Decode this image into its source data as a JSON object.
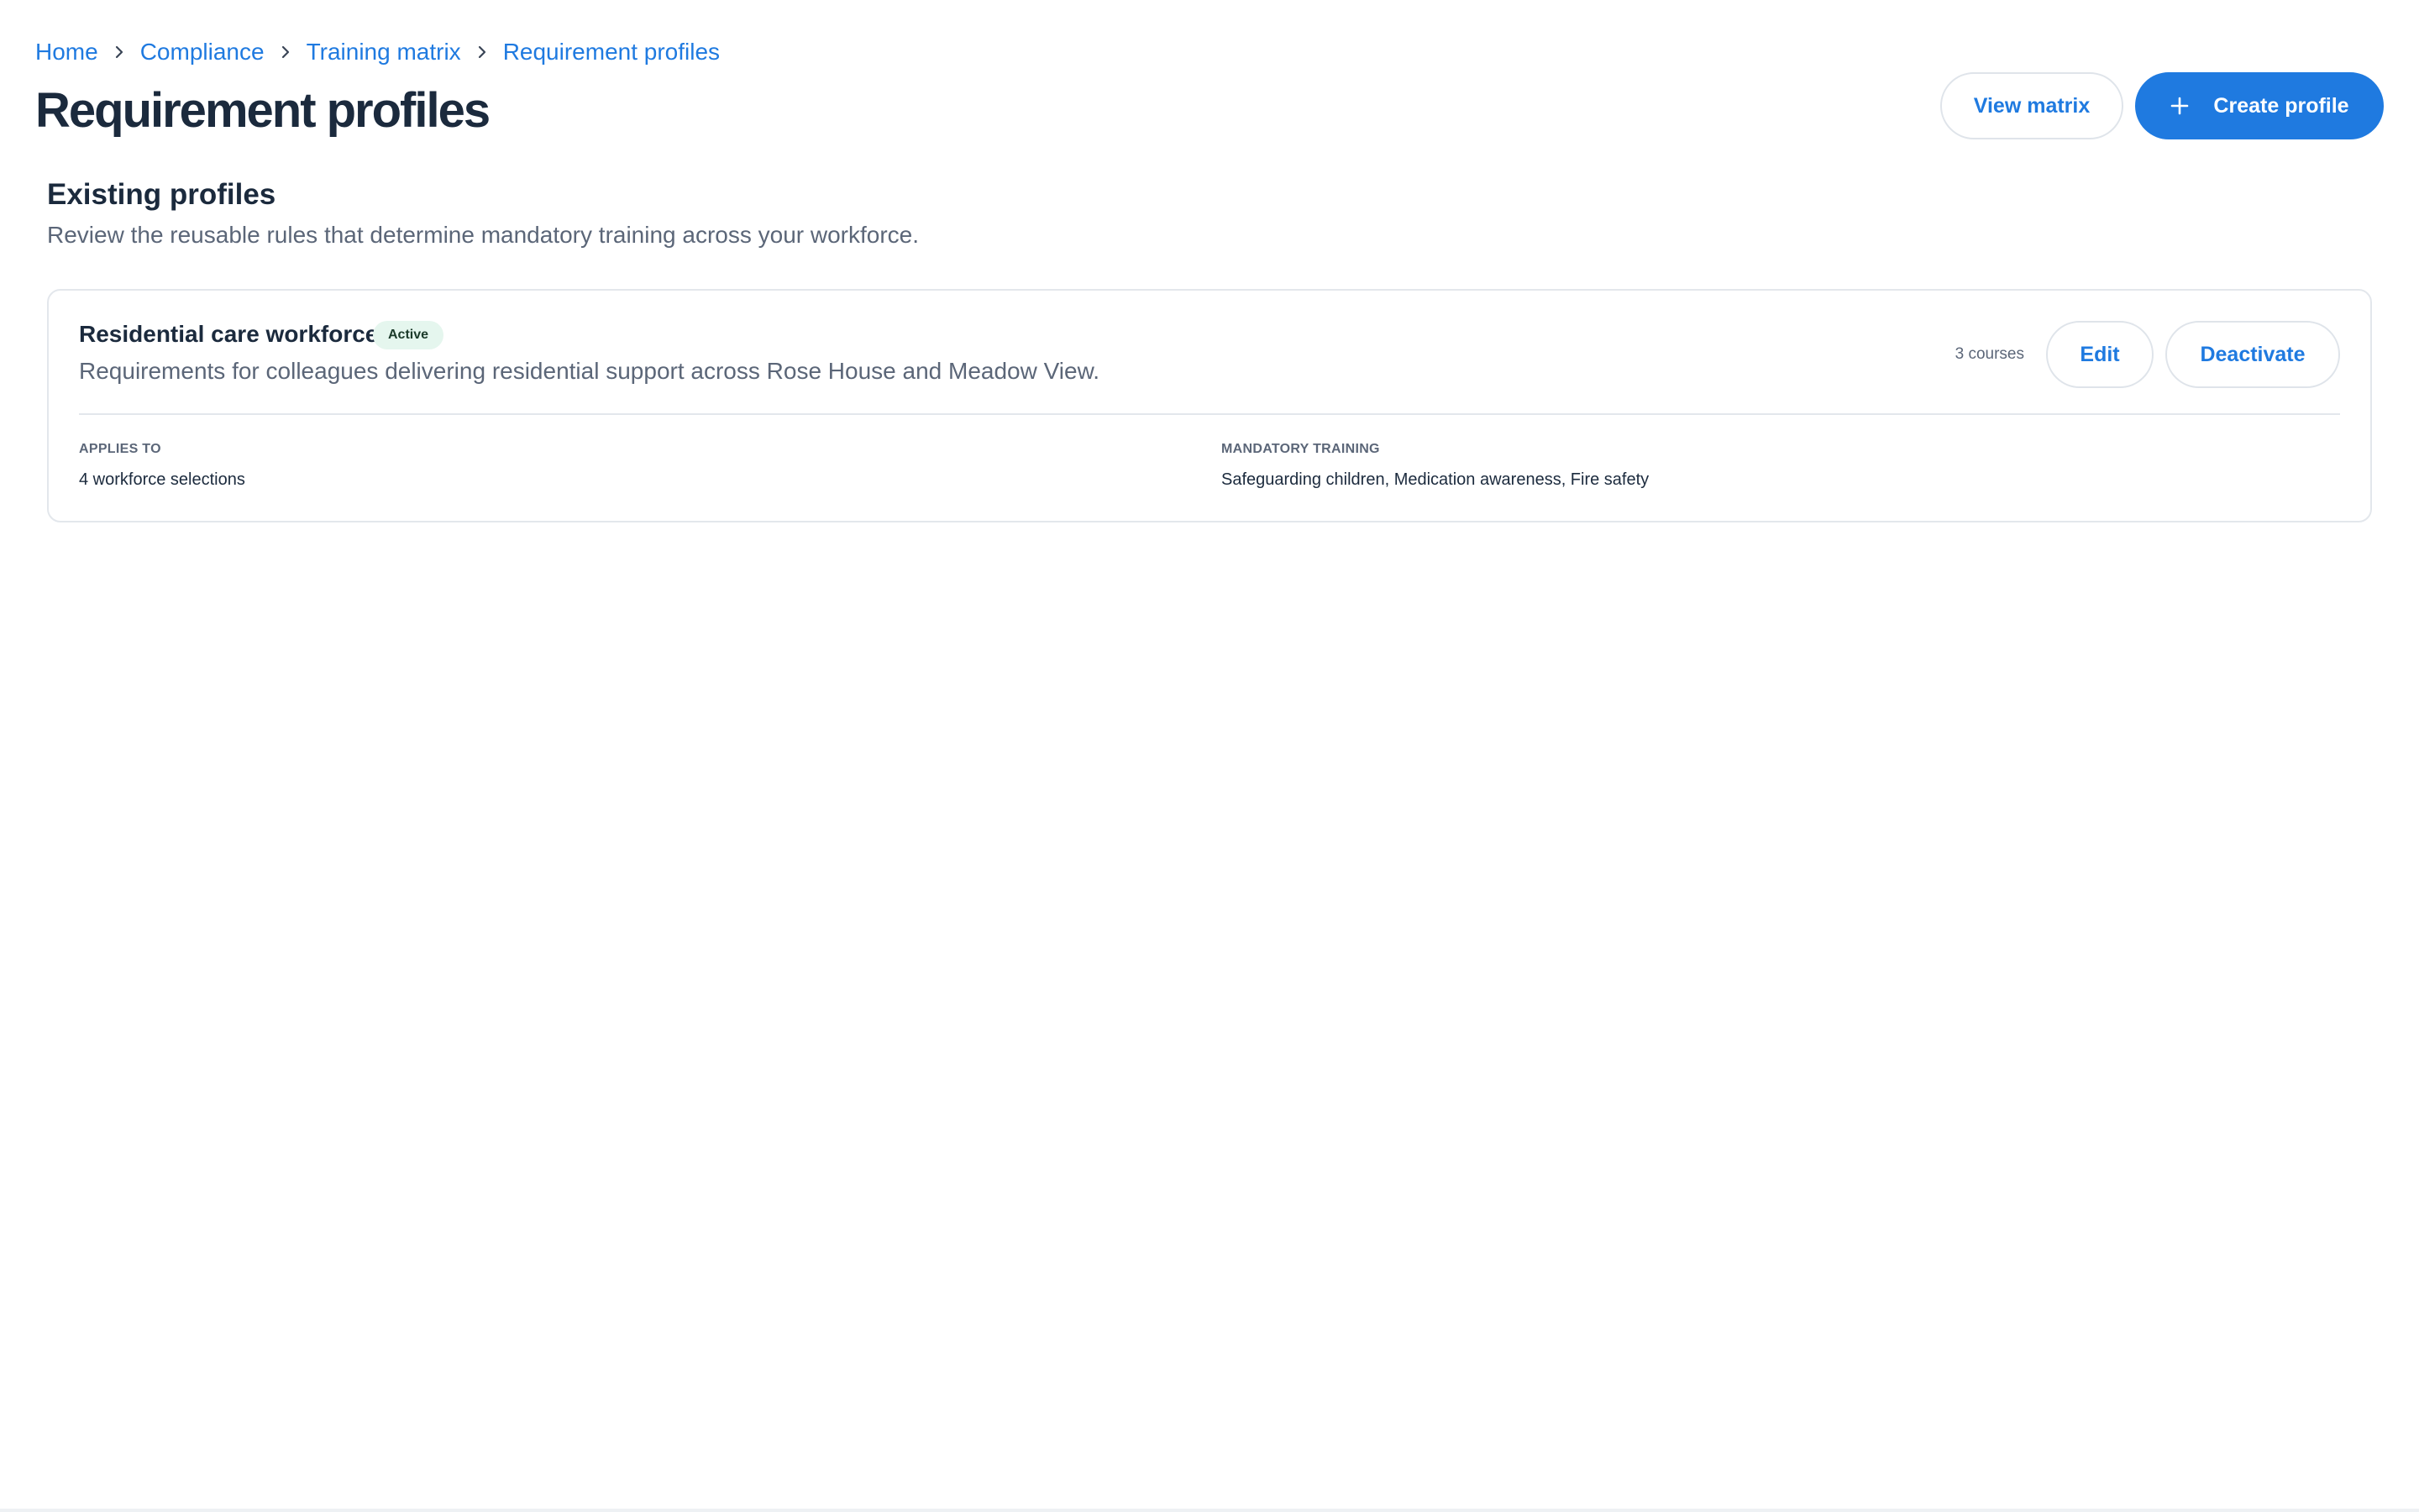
{
  "breadcrumb": {
    "items": [
      "Home",
      "Compliance",
      "Training matrix",
      "Requirement profiles"
    ]
  },
  "header": {
    "title": "Requirement profiles",
    "view_matrix_label": "View matrix",
    "create_profile_label": "Create profile"
  },
  "section": {
    "title": "Existing profiles",
    "description": "Review the reusable rules that determine mandatory training across your workforce."
  },
  "profiles": [
    {
      "name": "Residential care workforce",
      "status": "Active",
      "description": "Requirements for colleagues delivering residential support across Rose House and Meadow View.",
      "course_count": "3 courses",
      "edit_label": "Edit",
      "deactivate_label": "Deactivate",
      "applies_to_label": "APPLIES TO",
      "applies_to_value": "4 workforce selections",
      "mandatory_training_label": "MANDATORY TRAINING",
      "mandatory_training_value": "Safeguarding children, Medication awareness, Fire safety"
    }
  ],
  "icons": {
    "breadcrumb_separator": "chevron-right-icon",
    "create": "plus-icon"
  },
  "colors": {
    "accent": "#1f7ae0",
    "heading": "#1b2a3d",
    "muted": "#5b6678",
    "border": "#e3e7ec",
    "active_badge_bg": "#e5f6ee"
  }
}
